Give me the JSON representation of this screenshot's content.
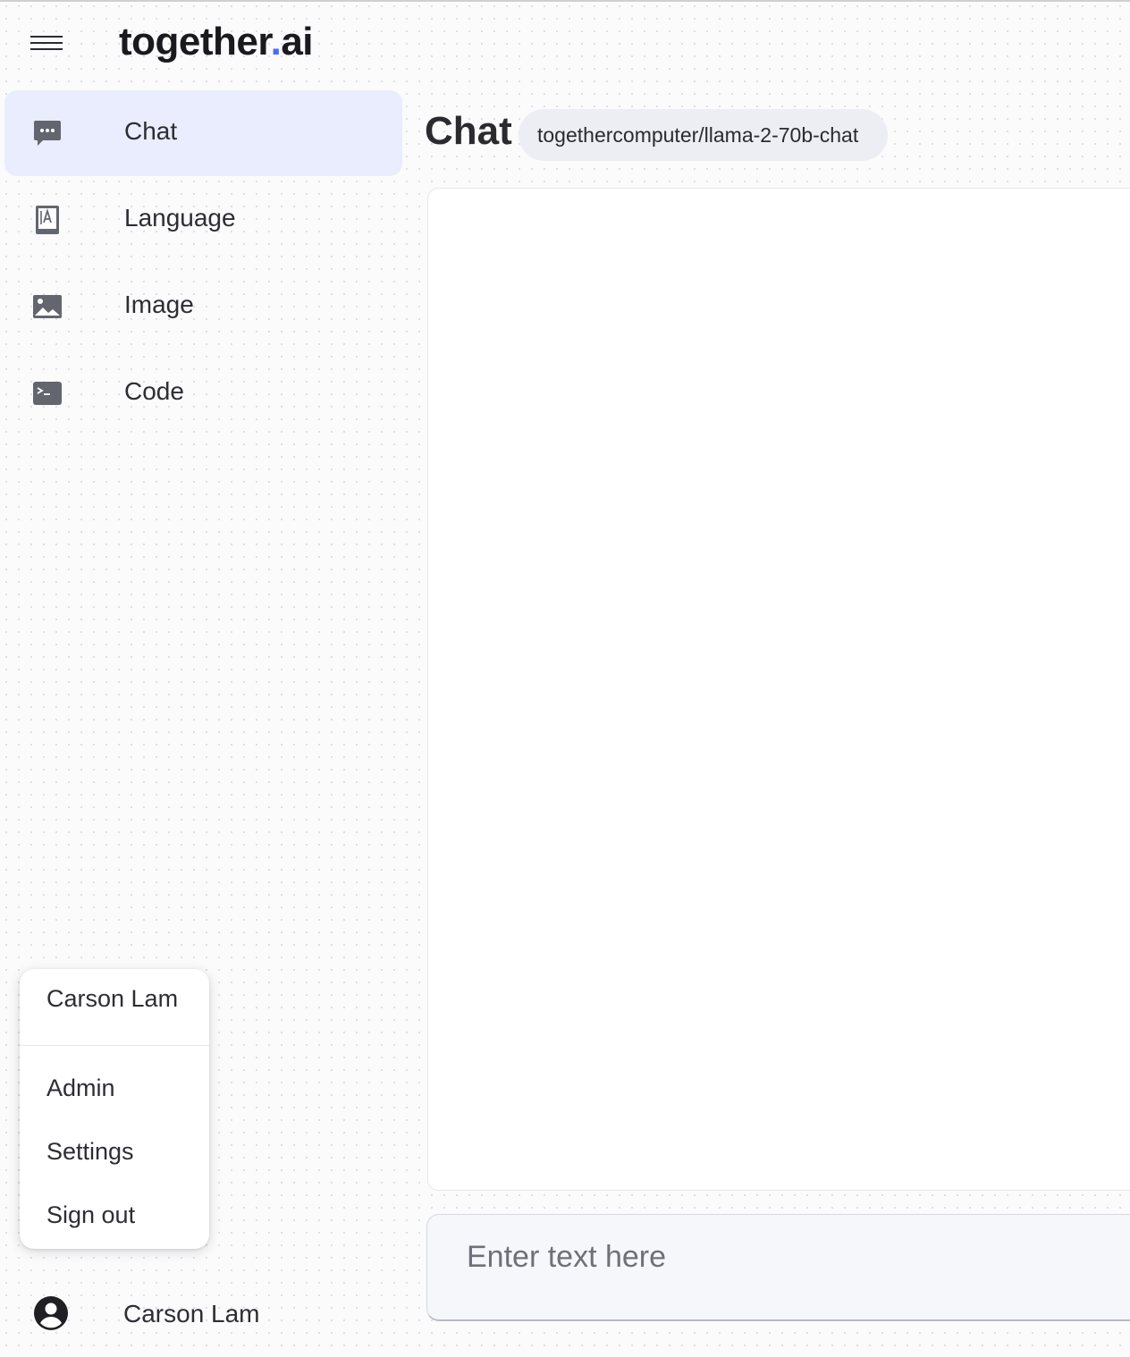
{
  "header": {
    "menu_icon": "hamburger-menu-icon",
    "logo_part1": "together",
    "logo_dot": ".",
    "logo_part2": "ai",
    "accent_color": "#4a6cf7"
  },
  "sidebar": {
    "items": [
      {
        "label": "Chat",
        "icon": "chat-bubble-icon",
        "active": true
      },
      {
        "label": "Language",
        "icon": "language-book-icon",
        "active": false
      },
      {
        "label": "Image",
        "icon": "image-icon",
        "active": false
      },
      {
        "label": "Code",
        "icon": "terminal-icon",
        "active": false
      }
    ],
    "active_bg": "#e9edfd"
  },
  "main": {
    "title": "Chat",
    "model": "togethercomputer/llama-2-70b-chat",
    "input_placeholder": "Enter text here"
  },
  "user_menu": {
    "name": "Carson Lam",
    "items": [
      "Admin",
      "Settings",
      "Sign out"
    ]
  },
  "user": {
    "name": "Carson Lam",
    "avatar_icon": "account-circle-icon"
  }
}
